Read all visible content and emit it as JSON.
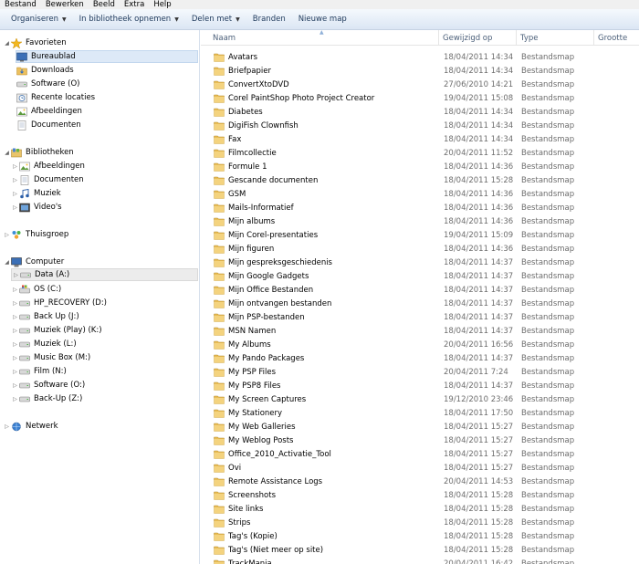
{
  "menu": [
    "Bestand",
    "Bewerken",
    "Beeld",
    "Extra",
    "Help"
  ],
  "toolbar": {
    "organize": "Organiseren",
    "include": "In bibliotheek opnemen",
    "share": "Delen met",
    "burn": "Branden",
    "new_folder": "Nieuwe map"
  },
  "nav": {
    "favorites": {
      "label": "Favorieten",
      "items": [
        "Bureaublad",
        "Downloads",
        "Software (O)",
        "Recente locaties",
        "Afbeeldingen",
        "Documenten"
      ]
    },
    "libraries": {
      "label": "Bibliotheken",
      "items": [
        "Afbeeldingen",
        "Documenten",
        "Muziek",
        "Video's"
      ]
    },
    "homegroup": "Thuisgroep",
    "computer": {
      "label": "Computer",
      "items": [
        "Data (A:)",
        "OS (C:)",
        "HP_RECOVERY (D:)",
        "Back Up (J:)",
        "Muziek (Play) (K:)",
        "Muziek (L:)",
        "Music Box (M:)",
        "Film (N:)",
        "Software (O:)",
        "Back-Up (Z:)"
      ]
    },
    "network": "Netwerk"
  },
  "columns": {
    "name": "Naam",
    "date": "Gewijzigd op",
    "type": "Type",
    "size": "Grootte"
  },
  "files": [
    {
      "name": "Avatars",
      "date": "18/04/2011 14:34",
      "type": "Bestandsmap"
    },
    {
      "name": "Briefpapier",
      "date": "18/04/2011 14:34",
      "type": "Bestandsmap"
    },
    {
      "name": "ConvertXtoDVD",
      "date": "27/06/2010 14:21",
      "type": "Bestandsmap"
    },
    {
      "name": "Corel PaintShop Photo Project Creator",
      "date": "19/04/2011 15:08",
      "type": "Bestandsmap"
    },
    {
      "name": "Diabetes",
      "date": "18/04/2011 14:34",
      "type": "Bestandsmap"
    },
    {
      "name": "DigiFish Clownfish",
      "date": "18/04/2011 14:34",
      "type": "Bestandsmap"
    },
    {
      "name": "Fax",
      "date": "18/04/2011 14:34",
      "type": "Bestandsmap"
    },
    {
      "name": "Filmcollectie",
      "date": "20/04/2011 11:52",
      "type": "Bestandsmap"
    },
    {
      "name": "Formule 1",
      "date": "18/04/2011 14:36",
      "type": "Bestandsmap"
    },
    {
      "name": "Gescande documenten",
      "date": "18/04/2011 15:28",
      "type": "Bestandsmap"
    },
    {
      "name": "GSM",
      "date": "18/04/2011 14:36",
      "type": "Bestandsmap"
    },
    {
      "name": "Mails-Informatief",
      "date": "18/04/2011 14:36",
      "type": "Bestandsmap"
    },
    {
      "name": "Mijn albums",
      "date": "18/04/2011 14:36",
      "type": "Bestandsmap"
    },
    {
      "name": "Mijn Corel-presentaties",
      "date": "19/04/2011 15:09",
      "type": "Bestandsmap"
    },
    {
      "name": "Mijn figuren",
      "date": "18/04/2011 14:36",
      "type": "Bestandsmap"
    },
    {
      "name": "Mijn gespreksgeschiedenis",
      "date": "18/04/2011 14:37",
      "type": "Bestandsmap"
    },
    {
      "name": "Mijn Google Gadgets",
      "date": "18/04/2011 14:37",
      "type": "Bestandsmap"
    },
    {
      "name": "Mijn Office Bestanden",
      "date": "18/04/2011 14:37",
      "type": "Bestandsmap"
    },
    {
      "name": "Mijn ontvangen bestanden",
      "date": "18/04/2011 14:37",
      "type": "Bestandsmap"
    },
    {
      "name": "Mijn PSP-bestanden",
      "date": "18/04/2011 14:37",
      "type": "Bestandsmap"
    },
    {
      "name": "MSN Namen",
      "date": "18/04/2011 14:37",
      "type": "Bestandsmap"
    },
    {
      "name": "My Albums",
      "date": "20/04/2011 16:56",
      "type": "Bestandsmap"
    },
    {
      "name": "My Pando Packages",
      "date": "18/04/2011 14:37",
      "type": "Bestandsmap"
    },
    {
      "name": "My PSP Files",
      "date": "20/04/2011 7:24",
      "type": "Bestandsmap"
    },
    {
      "name": "My PSP8 Files",
      "date": "18/04/2011 14:37",
      "type": "Bestandsmap"
    },
    {
      "name": "My Screen Captures",
      "date": "19/12/2010 23:46",
      "type": "Bestandsmap"
    },
    {
      "name": "My Stationery",
      "date": "18/04/2011 17:50",
      "type": "Bestandsmap"
    },
    {
      "name": "My Web Galleries",
      "date": "18/04/2011 15:27",
      "type": "Bestandsmap"
    },
    {
      "name": "My Weblog Posts",
      "date": "18/04/2011 15:27",
      "type": "Bestandsmap"
    },
    {
      "name": "Office_2010_Activatie_Tool",
      "date": "18/04/2011 15:27",
      "type": "Bestandsmap"
    },
    {
      "name": "Ovi",
      "date": "18/04/2011 15:27",
      "type": "Bestandsmap"
    },
    {
      "name": "Remote Assistance Logs",
      "date": "20/04/2011 14:53",
      "type": "Bestandsmap"
    },
    {
      "name": "Screenshots",
      "date": "18/04/2011 15:28",
      "type": "Bestandsmap"
    },
    {
      "name": "Site links",
      "date": "18/04/2011 15:28",
      "type": "Bestandsmap"
    },
    {
      "name": "Strips",
      "date": "18/04/2011 15:28",
      "type": "Bestandsmap"
    },
    {
      "name": "Tag's (Kopie)",
      "date": "18/04/2011 15:28",
      "type": "Bestandsmap"
    },
    {
      "name": "Tag's (Niet meer op site)",
      "date": "18/04/2011 15:28",
      "type": "Bestandsmap"
    },
    {
      "name": "TrackMania",
      "date": "20/04/2011 16:42",
      "type": "Bestandsmap"
    }
  ]
}
